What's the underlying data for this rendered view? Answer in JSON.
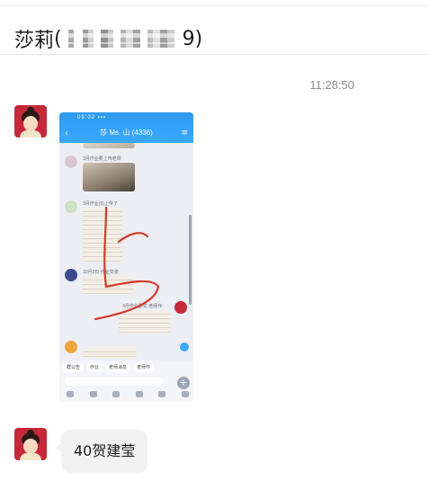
{
  "header": {
    "contact_name": "莎莉",
    "name_open": "(",
    "name_close": "9)"
  },
  "messages": [
    {
      "timestamp": "11:28:50",
      "sender": "avatar-costume",
      "type": "image",
      "image": {
        "app_title": "莎 Ms. 山 (4336)",
        "status_bar": "09:02 ▪▪▪",
        "tools": [
          "群公告",
          "作业",
          "老师消息",
          "老师作"
        ],
        "notes": [
          "3月作业要上传老师",
          "3月作业(5)上传了",
          "10月3日 作业交流",
          "3月作业要交 老师作"
        ],
        "annotation_stroke_color": "#d33a2c"
      }
    },
    {
      "sender": "avatar-costume",
      "type": "text",
      "text": "40贺建莹"
    }
  ],
  "colors": {
    "bubble": "#f1f1f1",
    "avatar": "#c6283a",
    "app_blue": "#3aa8ff"
  }
}
